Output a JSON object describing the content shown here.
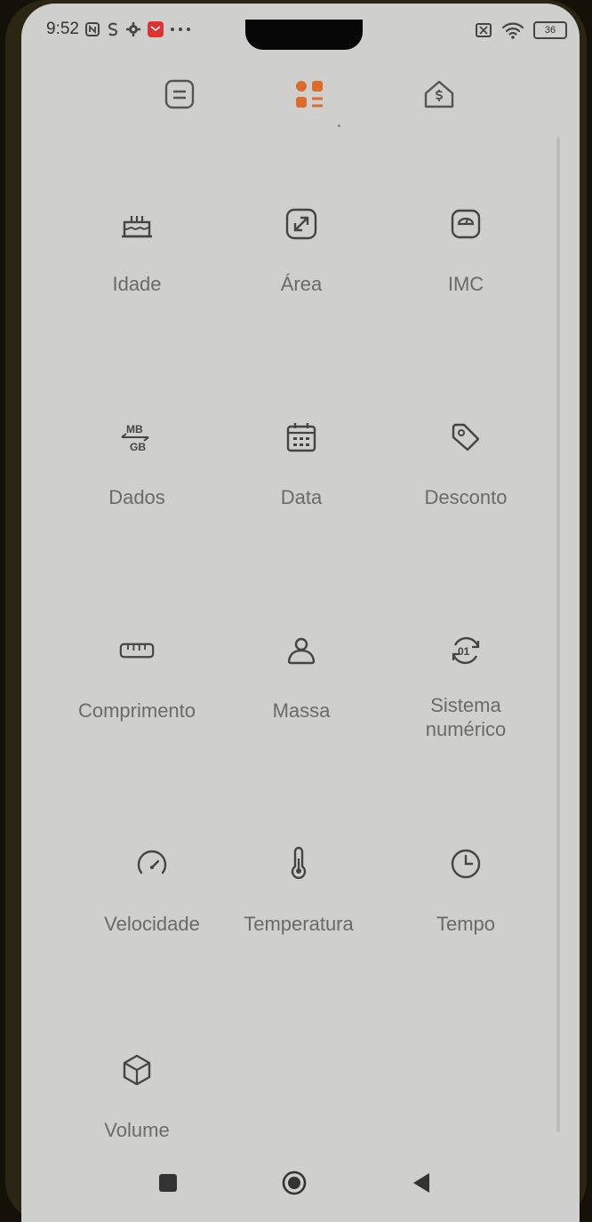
{
  "status": {
    "time": "9:52",
    "battery": "36"
  },
  "topnav": {
    "left_icon": "list-icon",
    "center_icon": "grid-icon",
    "right_icon": "currency-house-icon",
    "accent": "#e06a2a"
  },
  "tools": [
    {
      "label": "Idade",
      "icon": "cake-icon"
    },
    {
      "label": "Área",
      "icon": "resize-icon"
    },
    {
      "label": "IMC",
      "icon": "scale-icon"
    },
    {
      "label": "Dados",
      "icon": "data-mb-gb-icon"
    },
    {
      "label": "Data",
      "icon": "calendar-icon"
    },
    {
      "label": "Desconto",
      "icon": "tag-icon"
    },
    {
      "label": "Comprimento",
      "icon": "ruler-icon"
    },
    {
      "label": "Massa",
      "icon": "weight-icon"
    },
    {
      "label": "Sistema\nnumérico",
      "icon": "number-system-icon"
    },
    {
      "label": "Velocidade",
      "icon": "speedometer-icon"
    },
    {
      "label": "Temperatura",
      "icon": "thermometer-icon"
    },
    {
      "label": "Tempo",
      "icon": "clock-icon"
    },
    {
      "label": "Volume",
      "icon": "cube-icon"
    }
  ],
  "navbar": {
    "recents_icon": "square-icon",
    "home_icon": "circle-icon",
    "back_icon": "back-triangle-icon"
  }
}
